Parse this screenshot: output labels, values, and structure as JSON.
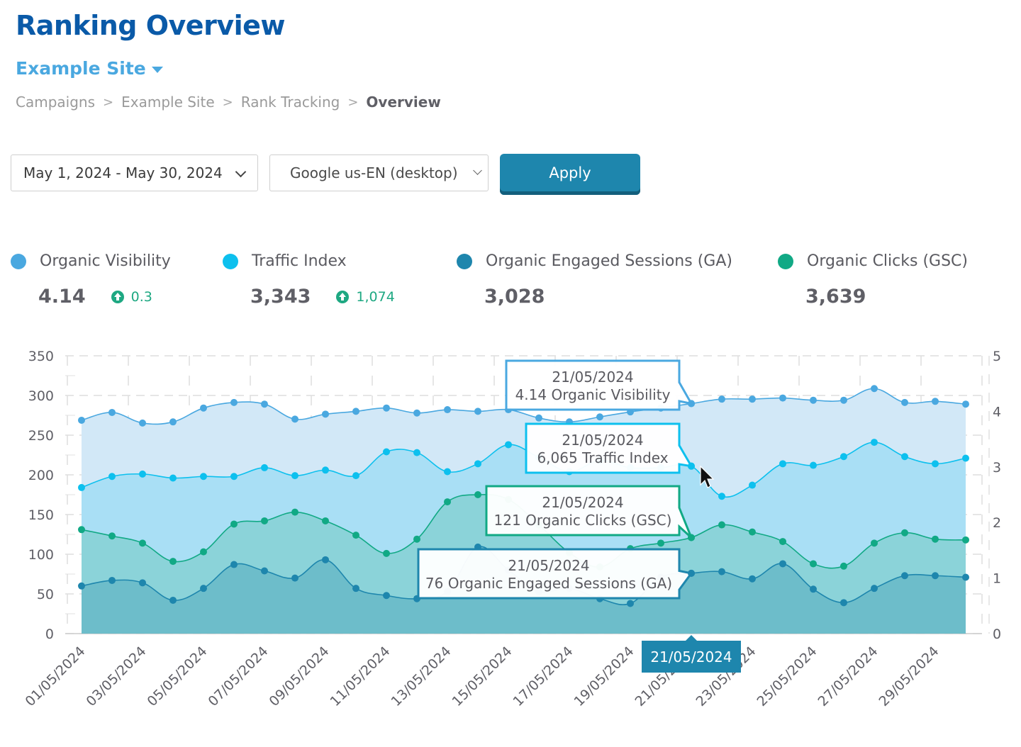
{
  "header": {
    "title": "Ranking Overview",
    "site_name": "Example Site",
    "breadcrumb": [
      "Campaigns",
      "Example Site",
      "Rank Tracking",
      "Overview"
    ],
    "breadcrumb_separator": ">"
  },
  "filters": {
    "date_range": "May 1, 2024 - May 30, 2024",
    "search_engine": "Google us-EN (desktop)",
    "apply_label": "Apply"
  },
  "metrics": [
    {
      "label": "Organic Visibility",
      "value": "4.14",
      "delta": "0.3",
      "color": "#4aa8e0"
    },
    {
      "label": "Traffic Index",
      "value": "3,343",
      "delta": "1,074",
      "color": "#0dc0ee"
    },
    {
      "label": "Organic Engaged Sessions (GA)",
      "value": "3,028",
      "delta": null,
      "color": "#1e86ad"
    },
    {
      "label": "Organic Clicks (GSC)",
      "value": "3,639",
      "delta": null,
      "color": "#11a985"
    }
  ],
  "colors": {
    "accent": "#1e86ad",
    "title": "#0a5aa8",
    "positive": "#1ea882"
  },
  "chart_data": {
    "type": "area",
    "title": "",
    "xlabel": "",
    "ylabel": "",
    "ylim": [
      0,
      350
    ],
    "y_ticks": [
      0,
      50,
      100,
      150,
      200,
      250,
      300,
      350
    ],
    "y2lim": [
      0,
      5
    ],
    "y2_ticks": [
      0,
      1,
      2,
      3,
      4,
      5
    ],
    "grid": true,
    "x": [
      "01/05/2024",
      "02/05/2024",
      "03/05/2024",
      "04/05/2024",
      "05/05/2024",
      "06/05/2024",
      "07/05/2024",
      "08/05/2024",
      "09/05/2024",
      "10/05/2024",
      "11/05/2024",
      "12/05/2024",
      "13/05/2024",
      "14/05/2024",
      "15/05/2024",
      "16/05/2024",
      "17/05/2024",
      "18/05/2024",
      "19/05/2024",
      "20/05/2024",
      "21/05/2024",
      "22/05/2024",
      "23/05/2024",
      "24/05/2024",
      "25/05/2024",
      "26/05/2024",
      "27/05/2024",
      "28/05/2024",
      "29/05/2024",
      "30/05/2024"
    ],
    "x_tick_labels": [
      "01/05/2024",
      "03/05/2024",
      "05/05/2024",
      "07/05/2024",
      "09/05/2024",
      "11/05/2024",
      "13/05/2024",
      "15/05/2024",
      "17/05/2024",
      "19/05/2024",
      "21/05/2024",
      "23/05/2024",
      "25/05/2024",
      "27/05/2024",
      "29/05/2024"
    ],
    "series": [
      {
        "name": "Organic Visibility",
        "axis": "right",
        "color": "#4aa8e0",
        "fill": "#d2e8f7",
        "values": [
          3.84,
          3.98,
          3.79,
          3.81,
          4.06,
          4.16,
          4.13,
          3.86,
          3.95,
          4.0,
          4.06,
          3.97,
          4.03,
          4.0,
          4.03,
          3.88,
          3.81,
          3.9,
          3.99,
          4.06,
          4.14,
          4.22,
          4.22,
          4.24,
          4.2,
          4.2,
          4.41,
          4.16,
          4.18,
          4.13
        ]
      },
      {
        "name": "Traffic Index",
        "axis": "left",
        "color": "#0dc0ee",
        "fill": "#a9dff5",
        "values": [
          184,
          198,
          201,
          196,
          198,
          198,
          209,
          199,
          206,
          199,
          229,
          228,
          204,
          214,
          238,
          222,
          204,
          218,
          209,
          209,
          211,
          173,
          187,
          214,
          212,
          223,
          241,
          223,
          214,
          221
        ]
      },
      {
        "name": "Organic Clicks (GSC)",
        "axis": "left",
        "color": "#11a985",
        "fill": "#8bd3d9",
        "values": [
          131,
          123,
          114,
          91,
          103,
          138,
          142,
          153,
          142,
          124,
          101,
          119,
          166,
          175,
          169,
          137,
          102,
          84,
          107,
          114,
          121,
          137,
          128,
          116,
          88,
          85,
          114,
          127,
          119,
          118
        ]
      },
      {
        "name": "Organic Engaged Sessions (GA)",
        "axis": "left",
        "color": "#1e86ad",
        "fill": "#6dbdca",
        "values": [
          60,
          67,
          64,
          42,
          57,
          87,
          79,
          70,
          93,
          57,
          48,
          44,
          53,
          109,
          80,
          53,
          57,
          44,
          38,
          71,
          76,
          78,
          69,
          88,
          56,
          39,
          57,
          73,
          73,
          71
        ]
      }
    ],
    "hover": {
      "date": "21/05/2024",
      "tooltips": [
        {
          "date": "21/05/2024",
          "text": "4.14 Organic Visibility",
          "series": "Organic Visibility",
          "color": "#4aa8e0"
        },
        {
          "date": "21/05/2024",
          "text": "6,065 Traffic Index",
          "series": "Traffic Index",
          "color": "#0dc0ee"
        },
        {
          "date": "21/05/2024",
          "text": "121 Organic Clicks (GSC)",
          "series": "Organic Clicks (GSC)",
          "color": "#11a985"
        },
        {
          "date": "21/05/2024",
          "text": "76 Organic Engaged Sessions (GA)",
          "series": "Organic Engaged Sessions (GA)",
          "color": "#1e86ad"
        }
      ],
      "x_label": "21/05/2024",
      "x_label_bg": "#1e86ad"
    }
  }
}
